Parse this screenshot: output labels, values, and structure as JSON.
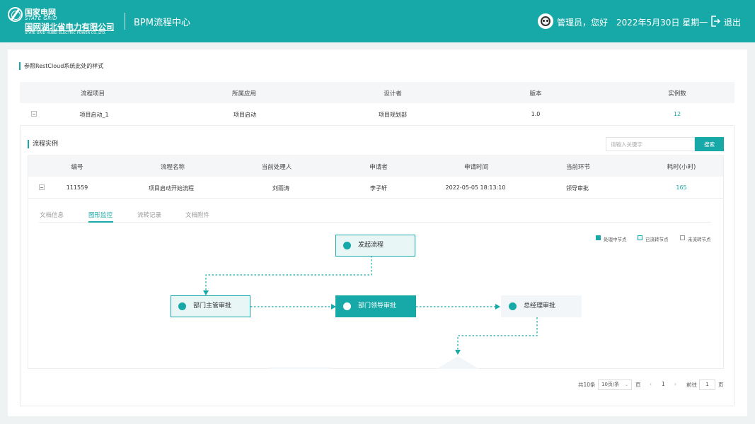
{
  "header": {
    "logo_cn_1": "国家电网",
    "logo_en_1": "STATE GRID",
    "logo_cn_2": "国网湖北省电力有限公司",
    "logo_en_2": "STATE GRID HUBEI ELECTRIC POWER CO.,LTD.",
    "system_title": "BPM流程中心",
    "greeting": "管理员，您好",
    "date": "2022年5月30日 星期一",
    "logout": "退出"
  },
  "note": "参照RestCloud系统此处的样式",
  "process_table": {
    "headers": [
      "流程项目",
      "所属应用",
      "设计者",
      "版本",
      "实例数"
    ],
    "row": [
      "项目启动_1",
      "项目启动",
      "项目规划部",
      "1.0",
      "12"
    ]
  },
  "instances": {
    "title": "流程实例",
    "search_placeholder": "请输入关键字",
    "search_button": "搜索",
    "headers": [
      "编号",
      "流程名称",
      "当前处理人",
      "申请者",
      "申请时间",
      "当前环节",
      "耗时(小时)"
    ],
    "row": [
      "111559",
      "项目启动开始流程",
      "刘雨涛",
      "李子轩",
      "2022-05-05 18:13:10",
      "领导审批",
      "165"
    ]
  },
  "tabs": [
    "文档信息",
    "图形监控",
    "流转记录",
    "文档附件"
  ],
  "legend": [
    "处理中节点",
    "已流转节点",
    "未流转节点"
  ],
  "flow_nodes": [
    "发起流程",
    "部门主管审批",
    "部门领导审批",
    "总经理审批"
  ],
  "pagination": {
    "total": "共10条",
    "page_size": "10页/条",
    "page_word": "页",
    "prev": "‹",
    "current": "1",
    "next": "›",
    "goto": "前往",
    "goto_value": "1",
    "goto_unit": "页"
  },
  "colors": {
    "primary": "#17a9a7",
    "node_done_bg": "#e8f6f5",
    "node_pending_bg": "#f3f6f9"
  }
}
